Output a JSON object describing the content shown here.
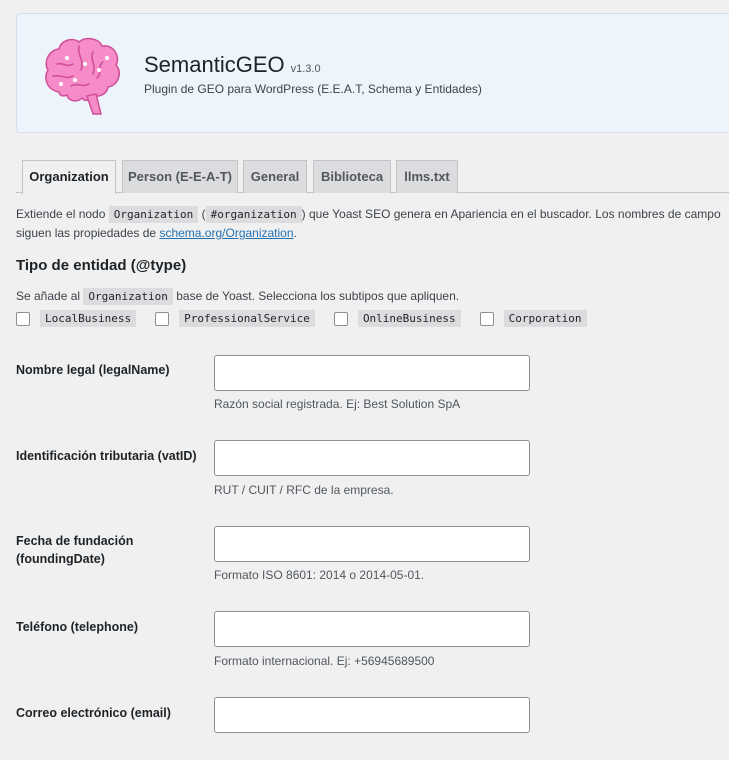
{
  "header": {
    "title": "SemanticGEO",
    "version": "v1.3.0",
    "subtitle": "Plugin de GEO para WordPress (E.E.A.T, Schema y Entidades)",
    "logo_icon": "brain-icon",
    "logo_color": "#f080c0"
  },
  "tabs": [
    {
      "label": "Organization",
      "active": true
    },
    {
      "label": "Person (E-E-A-T)",
      "active": false
    },
    {
      "label": "General",
      "active": false
    },
    {
      "label": "Biblioteca",
      "active": false
    },
    {
      "label": "llms.txt",
      "active": false
    }
  ],
  "intro": {
    "text1": "Extiende el nodo",
    "code1": "Organization",
    "text2": "(",
    "code2": "#organization",
    "text3": ") que Yoast SEO genera en Apariencia en el buscador. Los nombres de campo siguen las propiedades de",
    "link": "schema.org/Organization",
    "text4": "."
  },
  "entity_type": {
    "title": "Tipo de entidad (@type)",
    "desc_pre": "Se añade al",
    "desc_code": "Organization",
    "desc_post": "base de Yoast. Selecciona los subtipos que apliquen.",
    "options": [
      {
        "label": "LocalBusiness",
        "checked": false
      },
      {
        "label": "ProfessionalService",
        "checked": false
      },
      {
        "label": "OnlineBusiness",
        "checked": false
      },
      {
        "label": "Corporation",
        "checked": false
      }
    ]
  },
  "fields": [
    {
      "label": "Nombre legal (legalName)",
      "value": "",
      "help": "Razón social registrada. Ej: Best Solution SpA"
    },
    {
      "label": "Identificación tributaria (vatID)",
      "value": "",
      "help": "RUT / CUIT / RFC de la empresa."
    },
    {
      "label_line1": "Fecha de fundación",
      "label_line2": "(foundingDate)",
      "value": "",
      "help": "Formato ISO 8601: 2014 o 2014-05-01."
    },
    {
      "label": "Teléfono (telephone)",
      "value": "",
      "help": "Formato internacional. Ej: +56945689500"
    },
    {
      "label": "Correo electrónico (email)",
      "value": "",
      "help": ""
    }
  ]
}
